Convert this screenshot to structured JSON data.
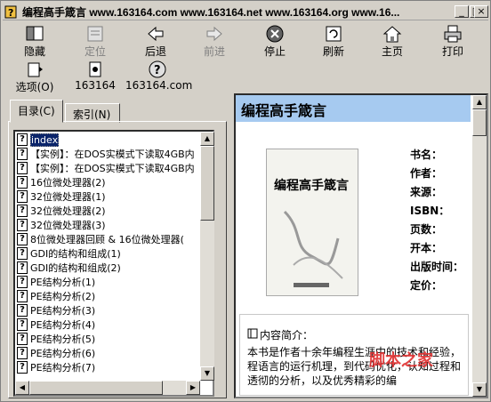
{
  "window": {
    "title": "编程高手箴言 www.163164.com www.163164.net www.163164.org www.16..."
  },
  "titlebar_buttons": {
    "minimize": "_",
    "maximize": "□",
    "close": "×"
  },
  "toolbar": {
    "row1": [
      {
        "label": "隐藏",
        "icon": "hide-icon"
      },
      {
        "label": "定位",
        "icon": "locate-icon",
        "disabled": true
      },
      {
        "label": "后退",
        "icon": "back-arrow-icon"
      },
      {
        "label": "前进",
        "icon": "forward-arrow-icon",
        "disabled": true
      },
      {
        "label": "停止",
        "icon": "stop-icon"
      },
      {
        "label": "刷新",
        "icon": "refresh-icon"
      },
      {
        "label": "主页",
        "icon": "home-icon"
      },
      {
        "label": "打印",
        "icon": "print-icon"
      }
    ],
    "row2": [
      {
        "label": "选项(O)",
        "icon": "options-icon"
      },
      {
        "label": "163164",
        "icon": "page-icon"
      },
      {
        "label": "163164.com",
        "icon": "help-icon"
      }
    ]
  },
  "tabs": [
    {
      "label": "目录(C)"
    },
    {
      "label": "索引(N)"
    }
  ],
  "tree_items": [
    "index",
    "【实例】：在DOS实模式下读取4GB内",
    "【实例】：在DOS实模式下读取4GB内",
    "16位微处理器(2)",
    "32位微处理器(1)",
    "32位微处理器(2)",
    "32位微处理器(3)",
    "8位微处理器回顾 & 16位微处理器(",
    "GDI的结构和组成(1)",
    "GDI的结构和组成(2)",
    "PE结构分析(1)",
    "PE结构分析(2)",
    "PE结构分析(3)",
    "PE结构分析(4)",
    "PE结构分析(5)",
    "PE结构分析(6)",
    "PE结构分析(7)"
  ],
  "content": {
    "book_title": "编程高手箴言",
    "cover_title": "编程高手箴言",
    "meta_labels": [
      "书名：",
      "作者：",
      "来源：",
      "ISBN：",
      "页数：",
      "开本：",
      "出版时间：",
      "定价："
    ],
    "intro_heading": "内容简介：",
    "intro_text": "本书是作者十余年编程生涯中的技术和经验，程语言的运行机理，到代码优化，认知过程和透彻的分析，以及优秀精彩的编",
    "watermark": "脚本之家"
  }
}
